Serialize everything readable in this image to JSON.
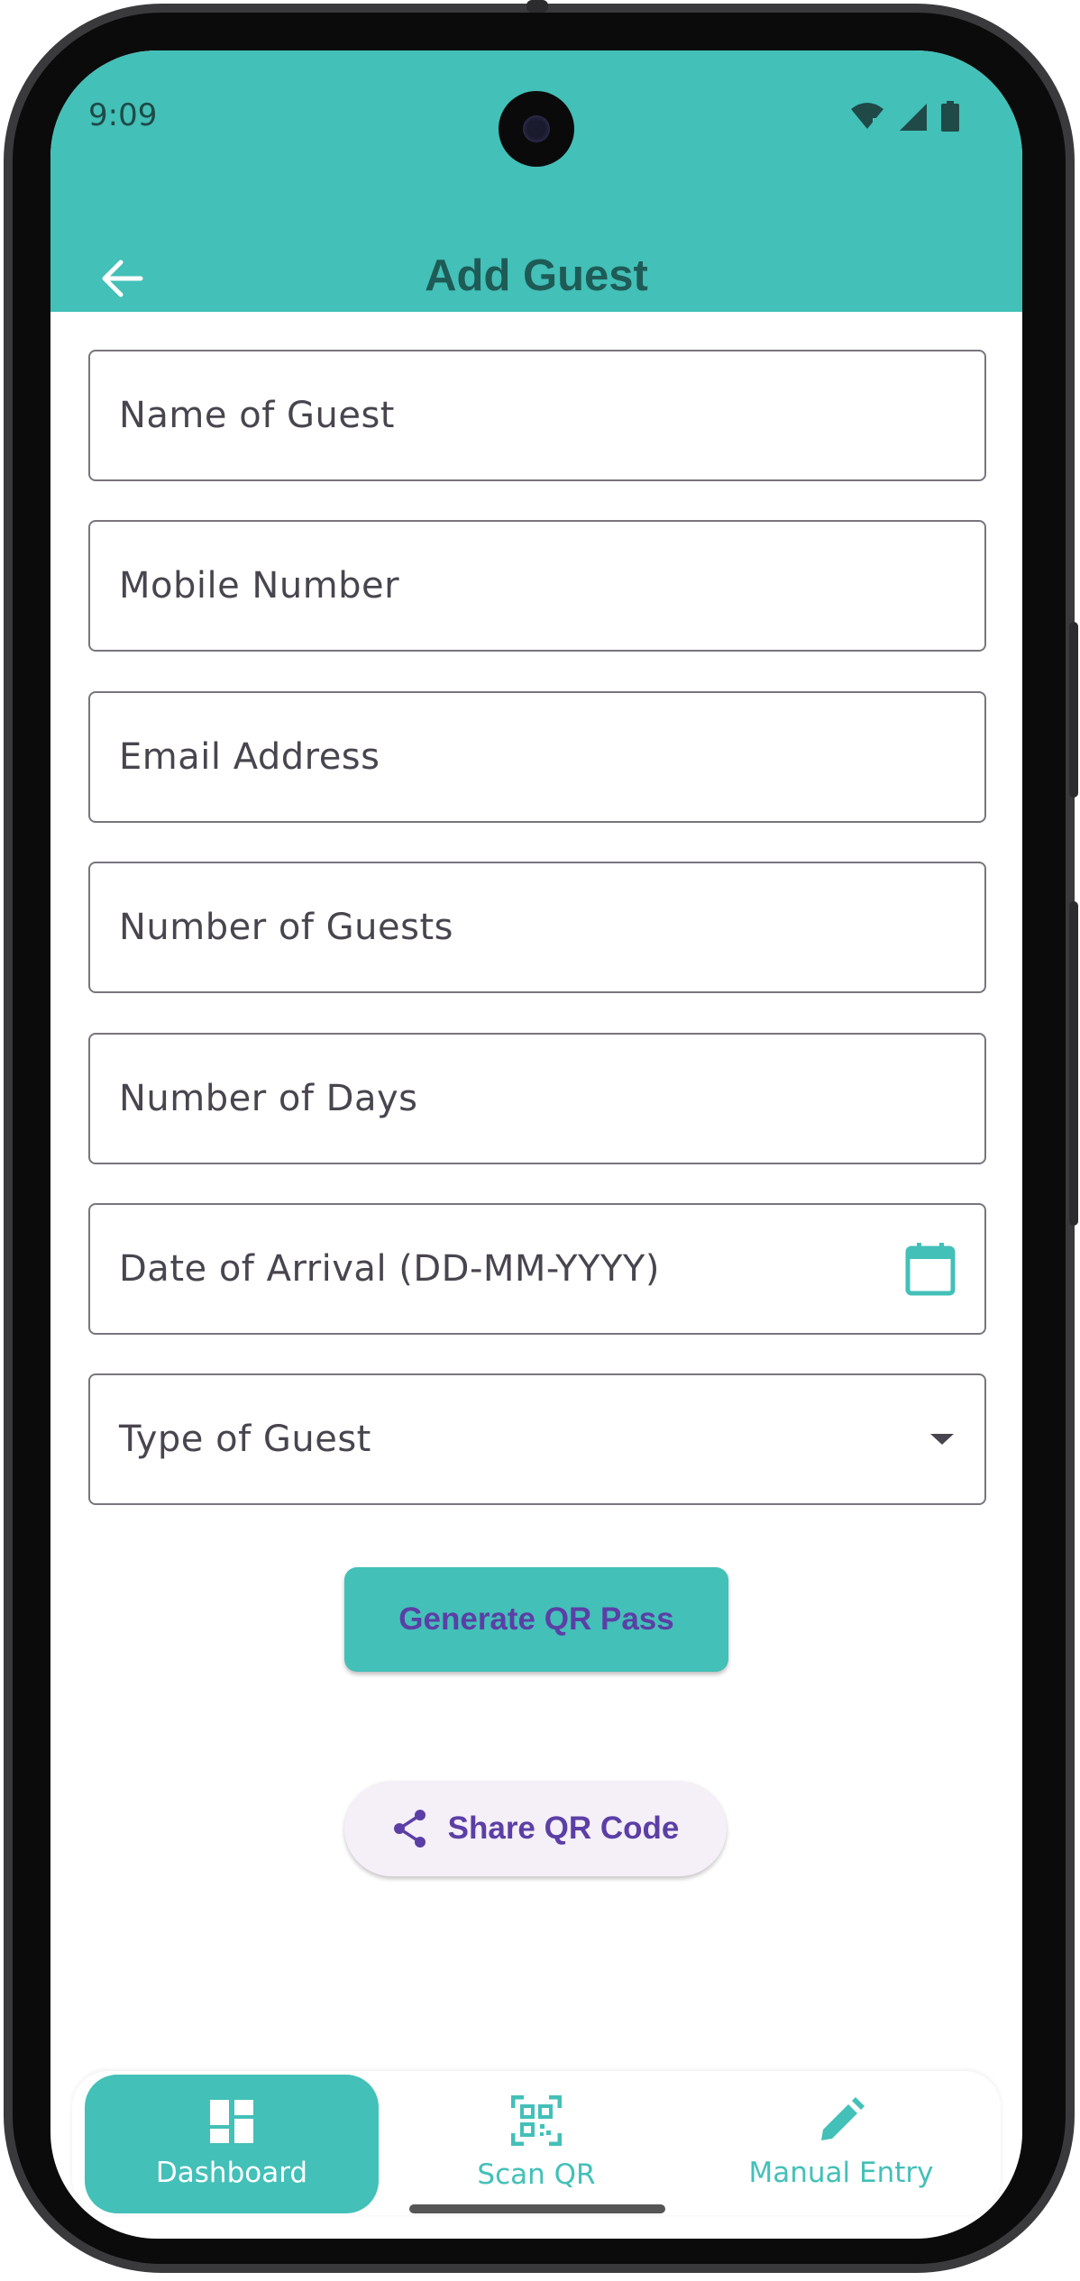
{
  "status_bar": {
    "time": "9:09"
  },
  "header": {
    "title": "Add Guest",
    "back_icon": "arrow-left-icon"
  },
  "form": {
    "name_placeholder": "Name of Guest",
    "mobile_placeholder": "Mobile Number",
    "email_placeholder": "Email Address",
    "guests_placeholder": "Number of Guests",
    "days_placeholder": "Number of Days",
    "arrival_placeholder": "Date of Arrival (DD-MM-YYYY)",
    "arrival_icon": "calendar-icon",
    "type_label": "Type of Guest",
    "type_icon": "dropdown-arrow-icon"
  },
  "actions": {
    "generate_label": "Generate QR Pass",
    "share_label": "Share QR Code",
    "share_icon": "share-icon"
  },
  "bottom_nav": {
    "items": [
      {
        "label": "Dashboard",
        "icon": "dashboard-icon",
        "active": true
      },
      {
        "label": "Scan QR",
        "icon": "qr-scan-icon",
        "active": false
      },
      {
        "label": "Manual Entry",
        "icon": "pencil-icon",
        "active": false
      }
    ]
  },
  "colors": {
    "accent": "#43c0b8",
    "title_text": "#1f5b56",
    "button_text": "#5b3fa6",
    "share_bg": "#f5eff7",
    "field_border": "#79747e"
  }
}
